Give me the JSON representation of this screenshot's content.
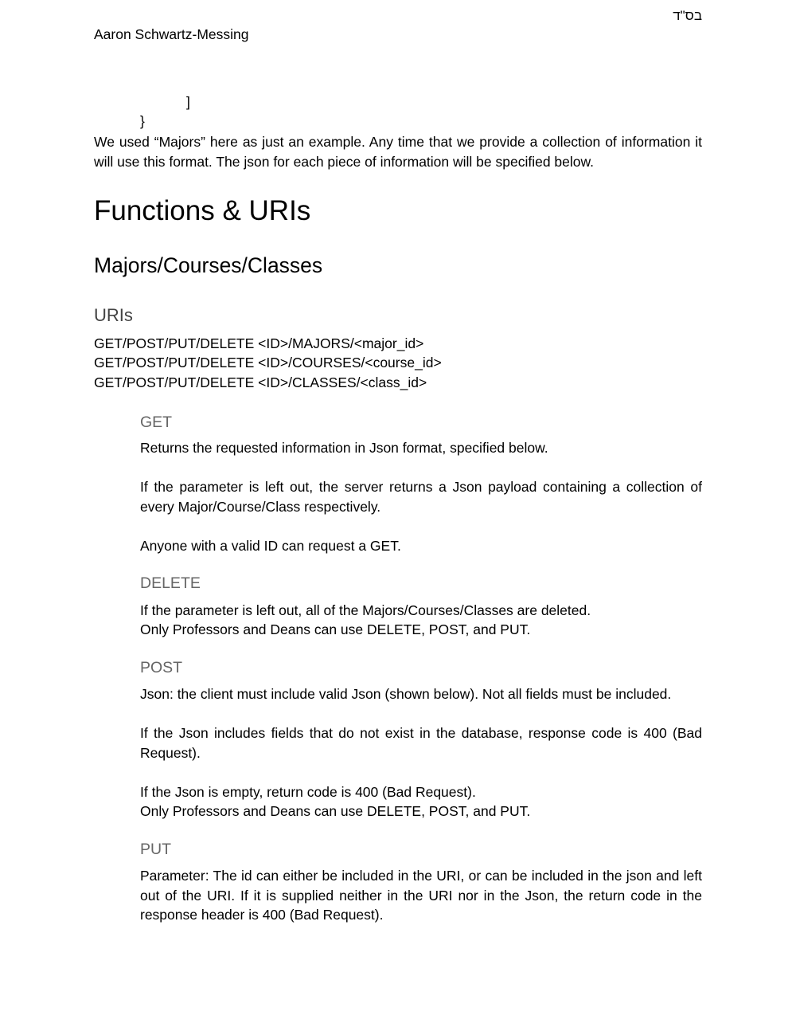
{
  "header": {
    "hebrew_mark": "בס\"ד",
    "author": "Aaron Schwartz-Messing"
  },
  "code_tail": {
    "bracket": "]",
    "brace": "}"
  },
  "intro": {
    "text": "We used “Majors” here as just an example. Any time that we provide a collection of information it will use this format. The json for each piece of information will be specified below."
  },
  "headings": {
    "functions": "Functions & URIs",
    "section": "Majors/Courses/Classes",
    "uris": "URIs"
  },
  "uris": [
    "GET/POST/PUT/DELETE <ID>/MAJORS/<major_id>",
    "GET/POST/PUT/DELETE <ID>/COURSES/<course_id>",
    "GET/POST/PUT/DELETE <ID>/CLASSES/<class_id>"
  ],
  "get": {
    "title": "GET",
    "p1": "Returns the requested information in Json format, specified below.",
    "p2": "If the parameter is left out, the server returns a Json payload containing a collection of every Major/Course/Class respectively.",
    "p3": "Anyone with a valid ID can request a GET."
  },
  "delete": {
    "title": "DELETE",
    "line1": "If the parameter is left out, all of the Majors/Courses/Classes are deleted.",
    "line2": "Only Professors and Deans can use DELETE, POST, and PUT."
  },
  "post": {
    "title": "POST",
    "p1": "Json: the client must include valid Json (shown below). Not all fields must be included.",
    "p2": "If the Json includes fields that do not exist in the database, response code is 400 (Bad Request).",
    "p3_line1": "If the Json is empty, return code is 400 (Bad Request).",
    "p3_line2": "Only Professors and Deans can use DELETE, POST, and PUT."
  },
  "put": {
    "title": "PUT",
    "p1": "Parameter: The id can either be included in the URI, or can be included in the json and left out of the URI. If it is supplied neither in the URI nor in the Json, the return code in the response header is 400 (Bad Request)."
  }
}
